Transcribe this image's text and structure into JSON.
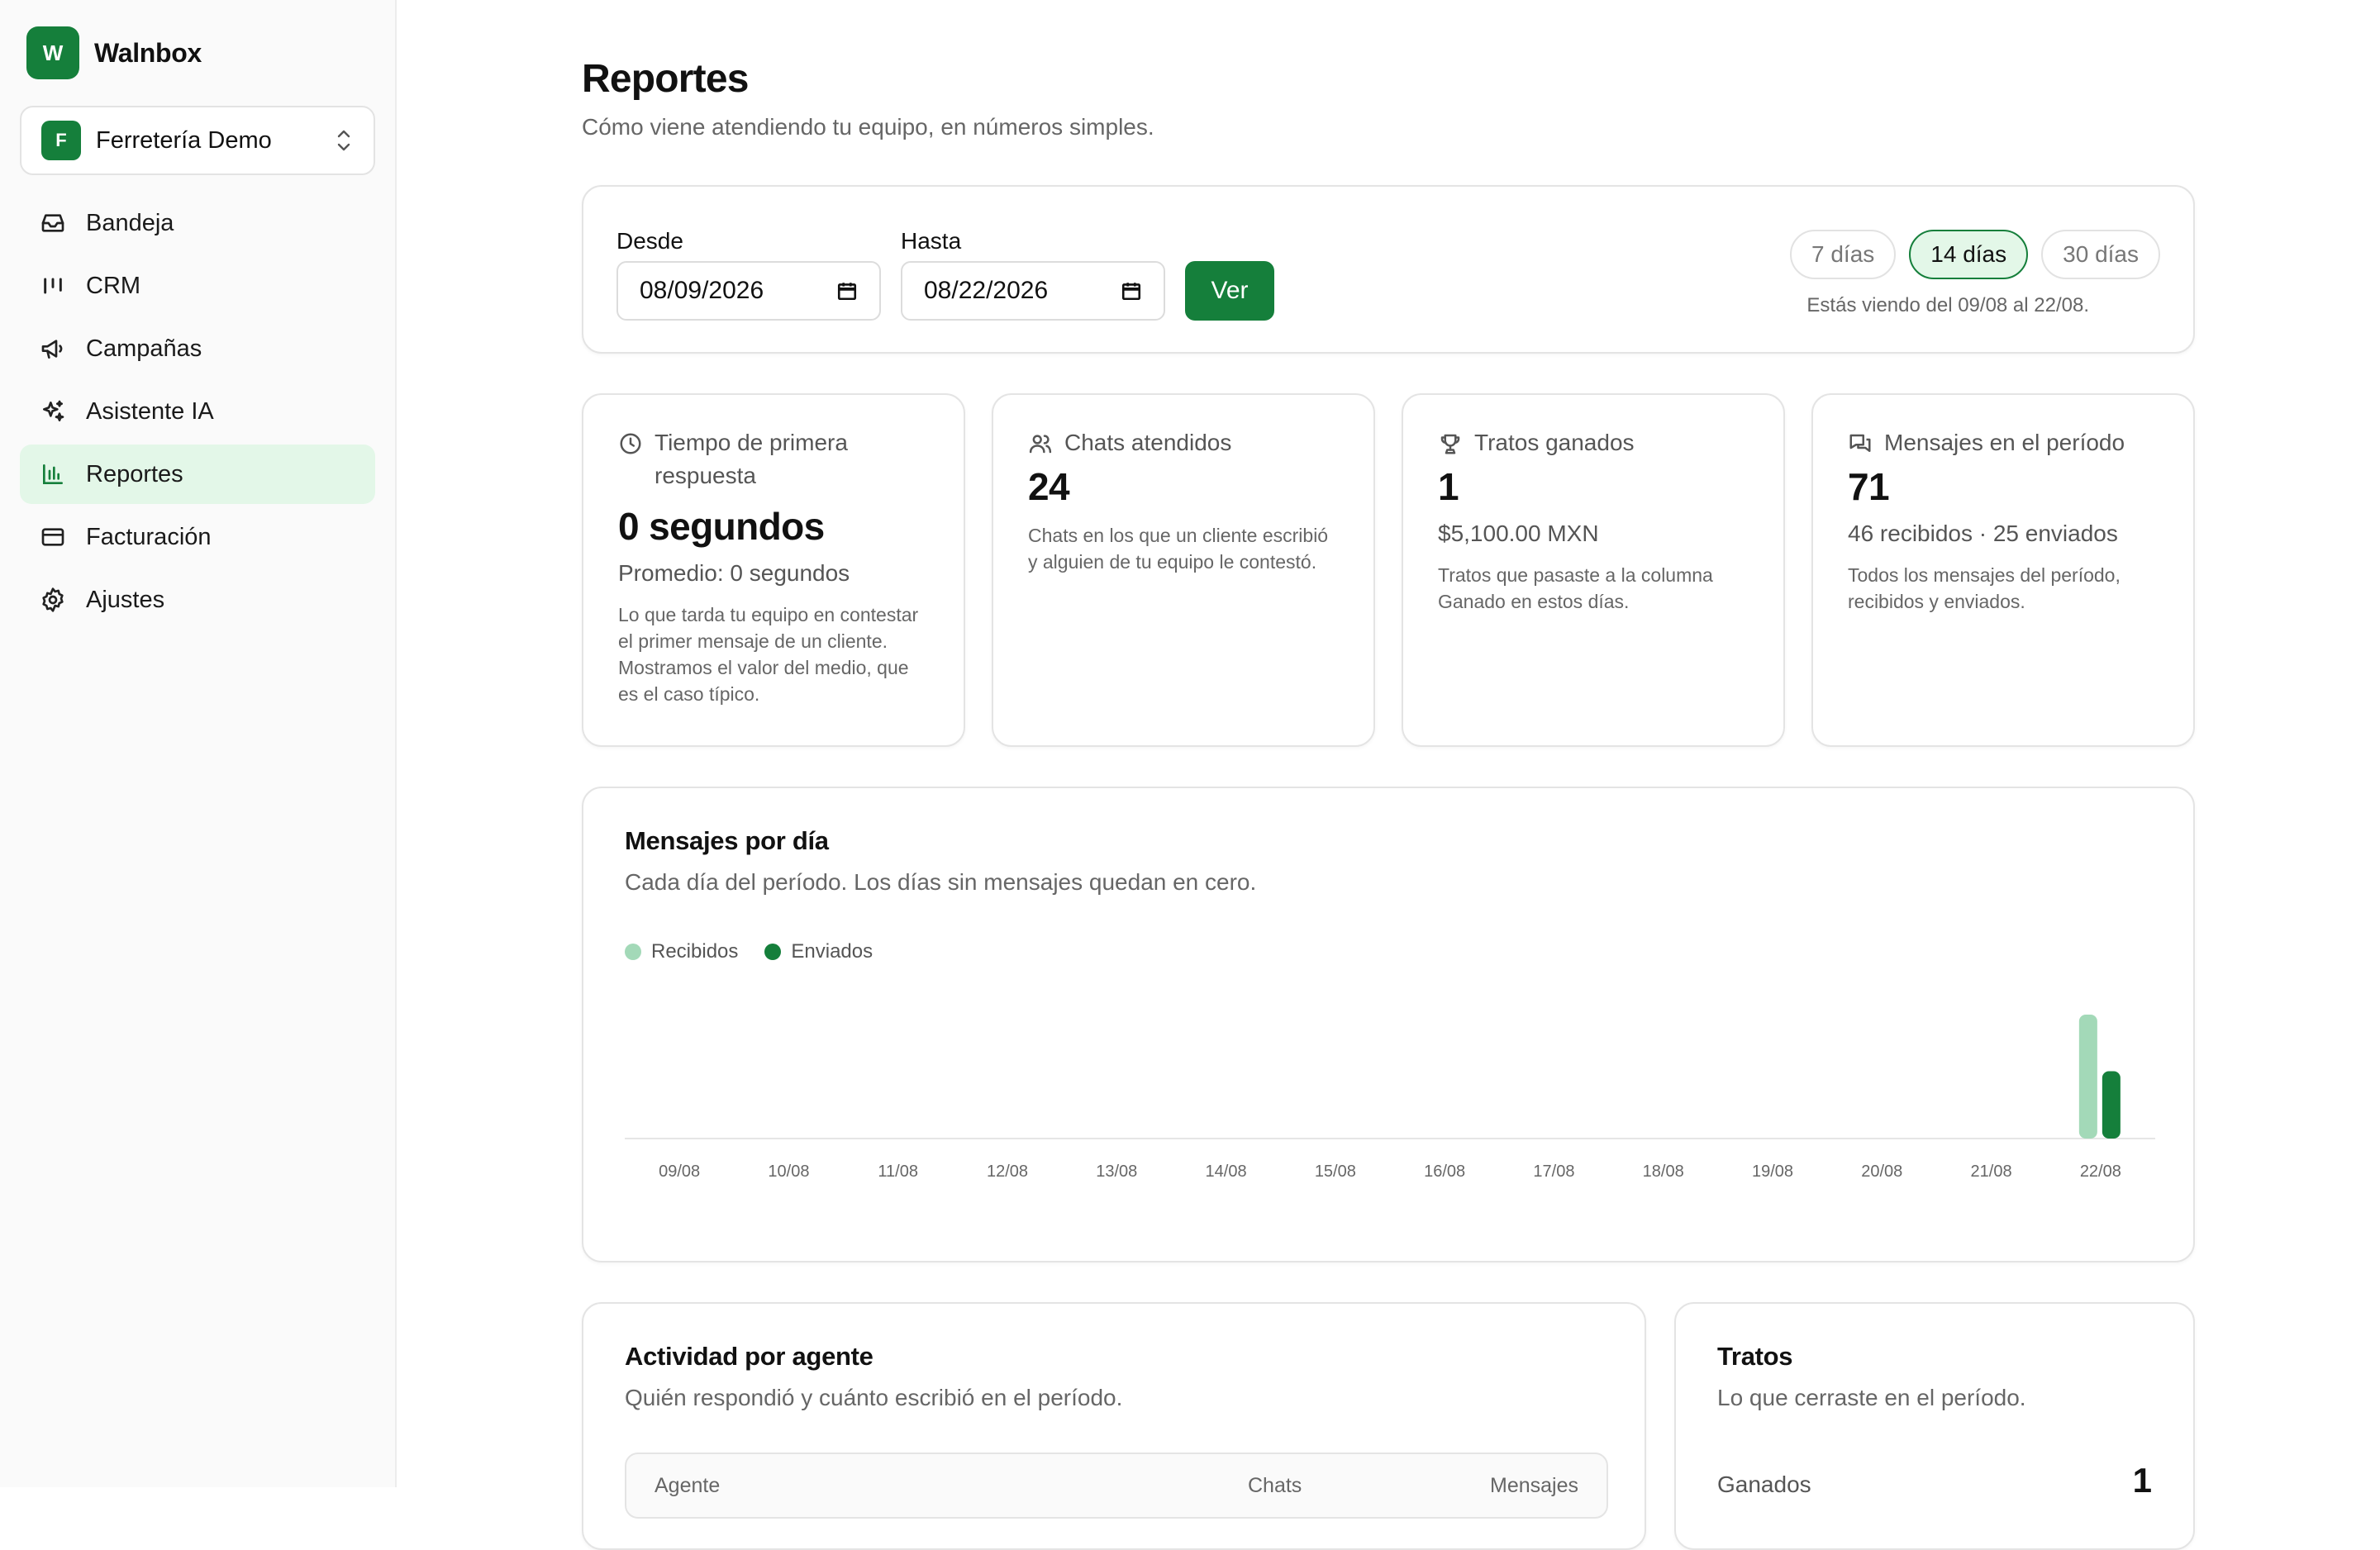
{
  "brand": {
    "logo_letter": "W",
    "name": "Walnbox"
  },
  "workspace": {
    "logo_letter": "F",
    "name": "Ferretería Demo"
  },
  "sidebar": {
    "items": [
      {
        "label": "Bandeja",
        "icon": "inbox-icon"
      },
      {
        "label": "CRM",
        "icon": "kanban-icon"
      },
      {
        "label": "Campañas",
        "icon": "megaphone-icon"
      },
      {
        "label": "Asistente IA",
        "icon": "sparkles-icon"
      },
      {
        "label": "Reportes",
        "icon": "bar-chart-icon",
        "active": true
      },
      {
        "label": "Facturación",
        "icon": "credit-card-icon"
      },
      {
        "label": "Ajustes",
        "icon": "gear-icon"
      }
    ]
  },
  "header": {
    "title": "Reportes",
    "subtitle": "Cómo viene atendiendo tu equipo, en números simples."
  },
  "filters": {
    "from_label": "Desde",
    "from_value": "08/09/2026",
    "to_label": "Hasta",
    "to_value": "08/22/2026",
    "submit_label": "Ver",
    "ranges": [
      "7 días",
      "14 días",
      "30 días"
    ],
    "active_range": "14 días",
    "range_note": "Estás viendo del 09/08 al 22/08."
  },
  "stats": [
    {
      "icon": "clock-icon",
      "label": "Tiempo de primera respuesta",
      "value": "0 segundos",
      "sub": "Promedio: 0 segundos",
      "desc": "Lo que tarda tu equipo en contestar el primer mensaje de un cliente. Mostramos el valor del medio, que es el caso típico."
    },
    {
      "icon": "users-icon",
      "label": "Chats atendidos",
      "value": "24",
      "sub": "",
      "desc": "Chats en los que un cliente escribió y alguien de tu equipo le contestó."
    },
    {
      "icon": "trophy-icon",
      "label": "Tratos ganados",
      "value": "1",
      "sub": "$5,100.00 MXN",
      "desc": "Tratos que pasaste a la columna Ganado en estos días."
    },
    {
      "icon": "messages-icon",
      "label": "Mensajes en el período",
      "value": "71",
      "sub": "46 recibidos · 25 enviados",
      "desc": "Todos los mensajes del período, recibidos y enviados."
    }
  ],
  "messages_chart": {
    "title": "Mensajes por día",
    "subtitle": "Cada día del período. Los días sin mensajes quedan en cero."
  },
  "colors": {
    "accent": "#157f3b",
    "received": "#a3d9b8",
    "sent": "#157f3b",
    "active_bg": "#e3f7e8"
  },
  "chart_data": {
    "type": "bar",
    "categories": [
      "09/08",
      "10/08",
      "11/08",
      "12/08",
      "13/08",
      "14/08",
      "15/08",
      "16/08",
      "17/08",
      "18/08",
      "19/08",
      "20/08",
      "21/08",
      "22/08"
    ],
    "series": [
      {
        "name": "Recibidos",
        "values": [
          0,
          0,
          0,
          0,
          0,
          0,
          0,
          0,
          0,
          0,
          0,
          0,
          0,
          46
        ]
      },
      {
        "name": "Enviados",
        "values": [
          0,
          0,
          0,
          0,
          0,
          0,
          0,
          0,
          0,
          0,
          0,
          0,
          0,
          25
        ]
      }
    ],
    "legend": "top-left",
    "grid": false,
    "ylim": [
      0,
      46
    ]
  },
  "agents": {
    "title": "Actividad por agente",
    "subtitle": "Quién respondió y cuánto escribió en el período.",
    "columns": [
      "Agente",
      "Chats",
      "Mensajes"
    ]
  },
  "deals": {
    "title": "Tratos",
    "subtitle": "Lo que cerraste en el período.",
    "rows": [
      {
        "label": "Ganados",
        "value": "1"
      }
    ]
  }
}
